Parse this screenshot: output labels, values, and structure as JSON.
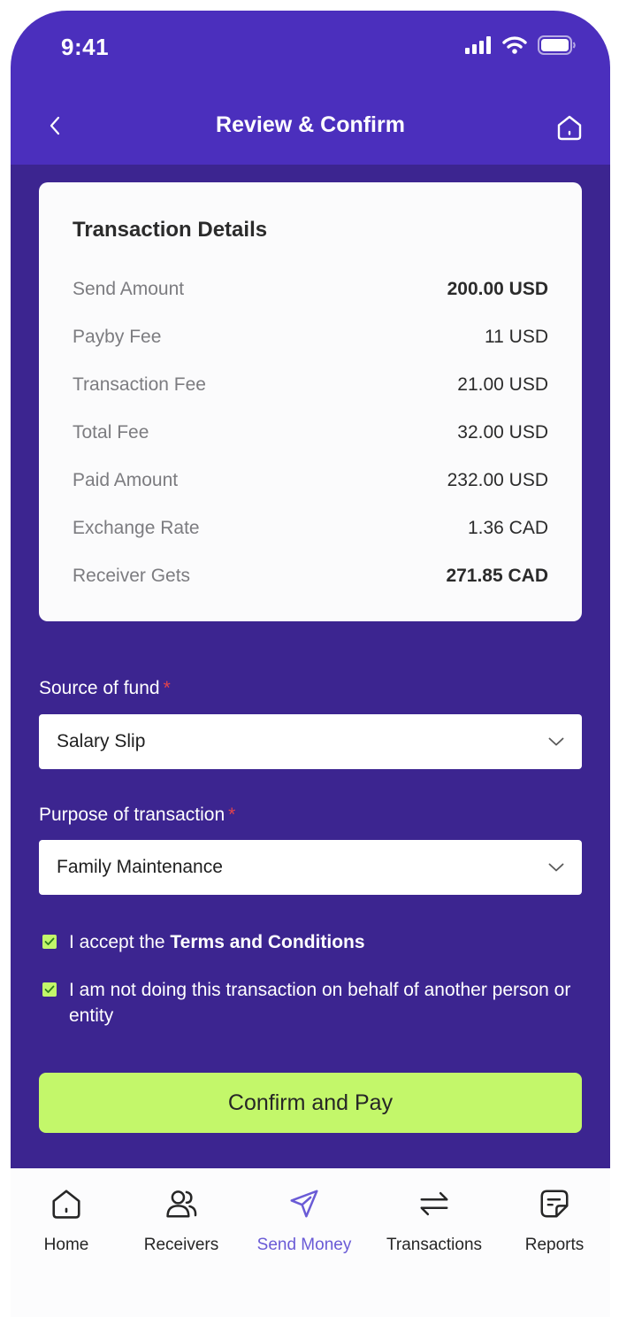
{
  "status_bar": {
    "time": "9:41"
  },
  "header": {
    "title": "Review & Confirm"
  },
  "card": {
    "title": "Transaction Details",
    "rows": [
      {
        "label": "Send Amount",
        "value": "200.00 USD"
      },
      {
        "label": "Payby Fee",
        "value": "11 USD"
      },
      {
        "label": "Transaction Fee",
        "value": "21.00 USD"
      },
      {
        "label": "Total Fee",
        "value": "32.00 USD"
      },
      {
        "label": "Paid Amount",
        "value": "232.00 USD"
      },
      {
        "label": "Exchange Rate",
        "value": "1.36 CAD"
      },
      {
        "label": "Receiver Gets",
        "value": "271.85 CAD"
      }
    ]
  },
  "form": {
    "source_label": "Source of fund",
    "source_value": "Salary Slip",
    "purpose_label": "Purpose of transaction",
    "purpose_value": "Family Maintenance",
    "required_mark": "*",
    "terms_prefix": "I accept the ",
    "terms_link": "Terms and Conditions",
    "behalf_text": "I am not doing this transaction on behalf of another person or entity",
    "confirm_label": "Confirm and Pay"
  },
  "tabs": [
    {
      "label": "Home",
      "icon": "home-icon"
    },
    {
      "label": "Receivers",
      "icon": "users-icon"
    },
    {
      "label": "Send Money",
      "icon": "send-icon"
    },
    {
      "label": "Transactions",
      "icon": "transfer-arrows-icon"
    },
    {
      "label": "Reports",
      "icon": "report-icon"
    }
  ],
  "colors": {
    "header": "#4b2fbd",
    "background": "#3c2590",
    "accent": "#c3f76a",
    "active_tab": "#6a5bd6",
    "required": "#e2434c"
  }
}
